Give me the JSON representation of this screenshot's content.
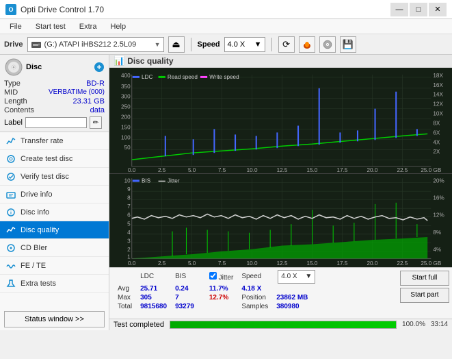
{
  "titlebar": {
    "title": "Opti Drive Control 1.70",
    "icon_label": "O",
    "min_label": "—",
    "max_label": "□",
    "close_label": "✕"
  },
  "menubar": {
    "items": [
      "File",
      "Start test",
      "Extra",
      "Help"
    ]
  },
  "toolbar": {
    "drive_label": "Drive",
    "drive_name": "(G:) ATAPI iHBS212 2.5L09",
    "speed_label": "Speed",
    "speed_value": "4.0 X"
  },
  "disc_panel": {
    "title": "Disc",
    "type_label": "Type",
    "type_value": "BD-R",
    "mid_label": "MID",
    "mid_value": "VERBATIMe (000)",
    "length_label": "Length",
    "length_value": "23.31 GB",
    "contents_label": "Contents",
    "contents_value": "data",
    "label_label": "Label"
  },
  "nav_items": [
    {
      "id": "transfer-rate",
      "label": "Transfer rate",
      "active": false
    },
    {
      "id": "create-test-disc",
      "label": "Create test disc",
      "active": false
    },
    {
      "id": "verify-test-disc",
      "label": "Verify test disc",
      "active": false
    },
    {
      "id": "drive-info",
      "label": "Drive info",
      "active": false
    },
    {
      "id": "disc-info",
      "label": "Disc info",
      "active": false
    },
    {
      "id": "disc-quality",
      "label": "Disc quality",
      "active": true
    },
    {
      "id": "cd-bier",
      "label": "CD BIer",
      "active": false
    },
    {
      "id": "fe-te",
      "label": "FE / TE",
      "active": false
    },
    {
      "id": "extra-tests",
      "label": "Extra tests",
      "active": false
    }
  ],
  "status_btn": "Status window >>",
  "chart_header": "Disc quality",
  "chart_top": {
    "legend": [
      {
        "label": "LDC",
        "color": "#4444ff"
      },
      {
        "label": "Read speed",
        "color": "#00dd00"
      },
      {
        "label": "Write speed",
        "color": "#ff44ff"
      }
    ],
    "y_labels_left": [
      "400",
      "350",
      "300",
      "250",
      "200",
      "150",
      "100",
      "50"
    ],
    "y_labels_right": [
      "18X",
      "16X",
      "14X",
      "12X",
      "10X",
      "8X",
      "6X",
      "4X",
      "2X"
    ],
    "x_labels": [
      "0.0",
      "2.5",
      "5.0",
      "7.5",
      "10.0",
      "12.5",
      "15.0",
      "17.5",
      "20.0",
      "22.5",
      "25.0 GB"
    ]
  },
  "chart_bottom": {
    "legend": [
      {
        "label": "BIS",
        "color": "#4444ff"
      },
      {
        "label": "Jitter",
        "color": "#dddddd"
      }
    ],
    "y_labels_left": [
      "10",
      "9",
      "8",
      "7",
      "6",
      "5",
      "4",
      "3",
      "2",
      "1"
    ],
    "y_labels_right": [
      "20%",
      "16%",
      "12%",
      "8%",
      "4%"
    ],
    "x_labels": [
      "0.0",
      "2.5",
      "5.0",
      "7.5",
      "10.0",
      "12.5",
      "15.0",
      "17.5",
      "20.0",
      "22.5",
      "25.0 GB"
    ]
  },
  "stats": {
    "col_ldc": "LDC",
    "col_bis": "BIS",
    "col_jitter": "Jitter",
    "col_speed": "Speed",
    "row_avg": "Avg",
    "row_max": "Max",
    "row_total": "Total",
    "avg_ldc": "25.71",
    "avg_bis": "0.24",
    "avg_jitter": "11.7%",
    "avg_speed": "4.18 X",
    "max_ldc": "305",
    "max_bis": "7",
    "max_jitter": "12.7%",
    "total_ldc": "9815680",
    "total_bis": "93279",
    "position_label": "Position",
    "position_value": "23862 MB",
    "samples_label": "Samples",
    "samples_value": "380980",
    "jitter_checked": true,
    "jitter_label": "Jitter",
    "speed_display": "4.0 X"
  },
  "buttons": {
    "start_full": "Start full",
    "start_part": "Start part"
  },
  "progress": {
    "value": 100.0,
    "text": "100.0%",
    "status": "Test completed",
    "time": "33:14"
  }
}
